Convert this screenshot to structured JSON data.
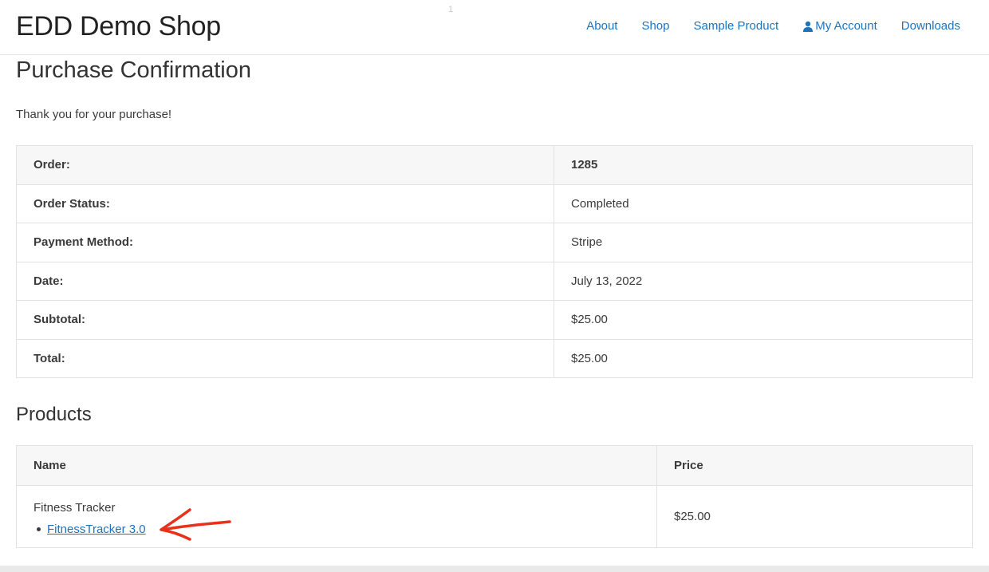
{
  "site": {
    "title": "EDD Demo Shop",
    "stray_mark": "1"
  },
  "nav": {
    "items": [
      {
        "label": "About"
      },
      {
        "label": "Shop"
      },
      {
        "label": "Sample Product"
      },
      {
        "label": "My Account",
        "icon": "user-icon"
      },
      {
        "label": "Downloads"
      }
    ]
  },
  "page": {
    "title": "Purchase Confirmation",
    "thanks": "Thank you for your purchase!"
  },
  "receipt": {
    "rows": [
      {
        "label": "Order:",
        "value": "1285"
      },
      {
        "label": "Order Status:",
        "value": "Completed"
      },
      {
        "label": "Payment Method:",
        "value": "Stripe"
      },
      {
        "label": "Date:",
        "value": "July 13, 2022"
      },
      {
        "label": "Subtotal:",
        "value": "$25.00"
      },
      {
        "label": "Total:",
        "value": "$25.00"
      }
    ]
  },
  "products": {
    "title": "Products",
    "headers": {
      "name": "Name",
      "price": "Price"
    },
    "items": [
      {
        "name": "Fitness Tracker",
        "download": "FitnessTracker 3.0",
        "price": "$25.00"
      }
    ]
  },
  "colors": {
    "link": "#1e73be",
    "annotation_arrow": "#e8301c"
  }
}
